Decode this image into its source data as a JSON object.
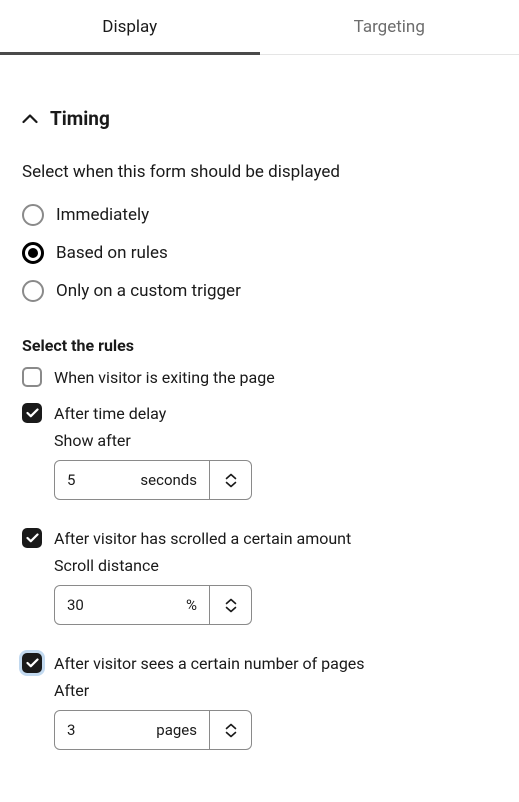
{
  "tabs": {
    "display": "Display",
    "targeting": "Targeting"
  },
  "section": {
    "title": "Timing",
    "description": "Select when this form should be displayed"
  },
  "timing_options": {
    "immediately": "Immediately",
    "based_on_rules": "Based on rules",
    "custom_trigger": "Only on a custom trigger"
  },
  "rules": {
    "title": "Select the rules",
    "exit_intent": {
      "label": "When visitor is exiting the page"
    },
    "time_delay": {
      "label": "After time delay",
      "sub_label": "Show after",
      "value": "5",
      "unit": "seconds"
    },
    "scroll": {
      "label": "After visitor has scrolled a certain amount",
      "sub_label": "Scroll distance",
      "value": "30",
      "unit": "%"
    },
    "pages": {
      "label": "After visitor sees a certain number of pages",
      "sub_label": "After",
      "value": "3",
      "unit": "pages"
    }
  }
}
